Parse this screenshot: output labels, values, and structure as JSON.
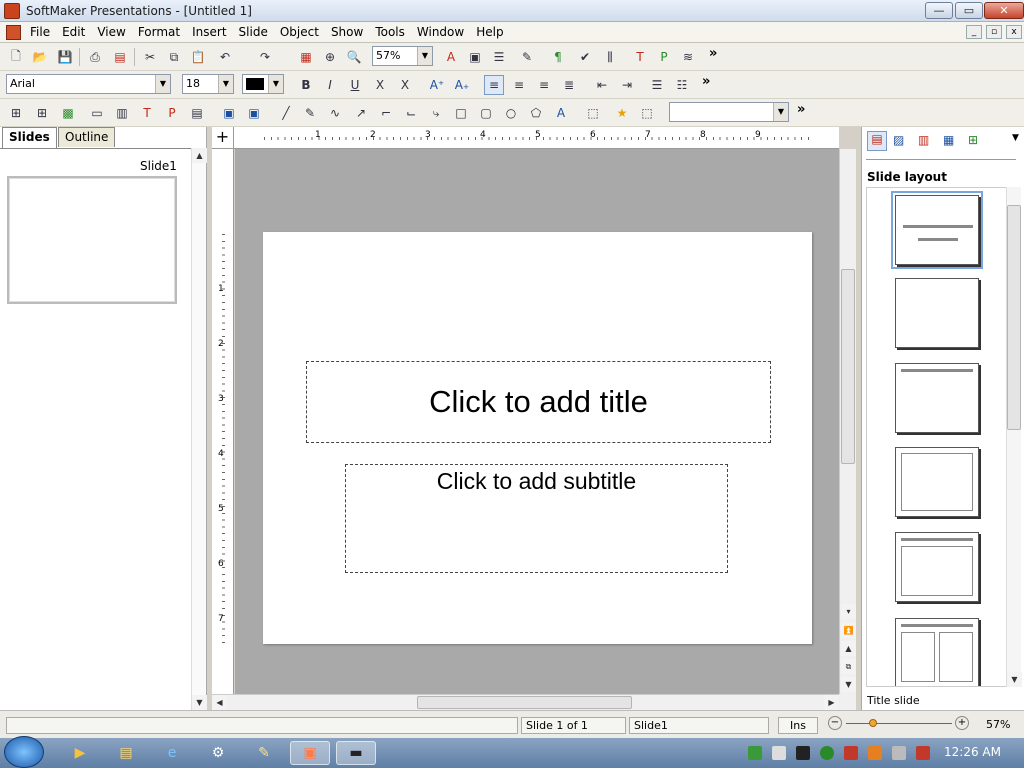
{
  "window": {
    "title": "SoftMaker Presentations - [Untitled 1]",
    "min": "—",
    "max": "▭",
    "close": "✕"
  },
  "menu": [
    "File",
    "Edit",
    "View",
    "Format",
    "Insert",
    "Slide",
    "Object",
    "Show",
    "Tools",
    "Window",
    "Help"
  ],
  "toolbar1": {
    "zoom": "57%"
  },
  "toolbar2": {
    "font": "Arial",
    "size": "18"
  },
  "toolbar3": {
    "style_combo": ""
  },
  "left_pane": {
    "tabs": [
      "Slides",
      "Outline"
    ],
    "thumbnail_label": "Slide1"
  },
  "slide": {
    "title_placeholder": "Click to add title",
    "subtitle_placeholder": "Click to add subtitle"
  },
  "right_pane": {
    "heading": "Slide layout",
    "caption": "Title slide"
  },
  "status": {
    "slide_pos": "Slide 1 of 1",
    "slide_name": "Slide1",
    "mode": "Ins",
    "zoom": "57%"
  },
  "taskbar": {
    "time": "12:26 AM"
  },
  "ruler": {
    "h": [
      "1",
      "2",
      "3",
      "4",
      "5",
      "6",
      "7",
      "8",
      "9"
    ],
    "v": [
      "1",
      "2",
      "3",
      "4",
      "5",
      "6",
      "7"
    ]
  }
}
